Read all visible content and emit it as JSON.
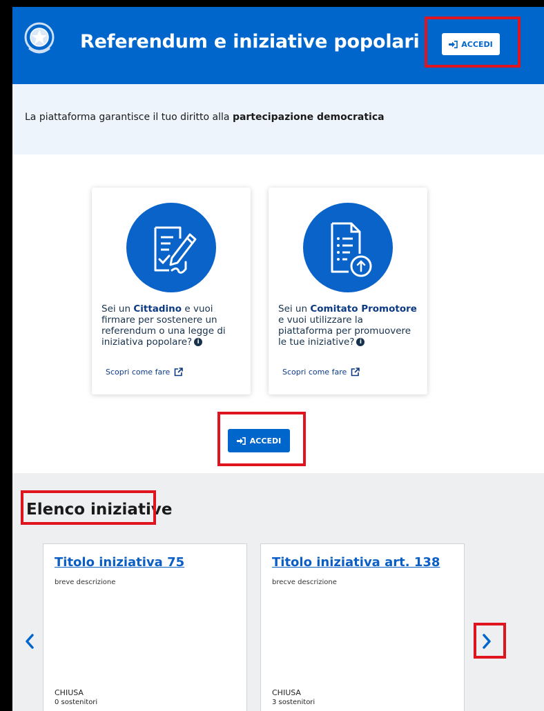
{
  "header": {
    "title": "Referendum e iniziative popolari",
    "login_label": "ACCEDI"
  },
  "intro": {
    "text_plain": "La piattaforma garantisce il tuo diritto alla ",
    "text_bold": "partecipazione democratica"
  },
  "cards": [
    {
      "pre": "Sei un ",
      "role": "Cittadino",
      "post": " e vuoi firmare per sostenere un referendum o una legge di iniziativa popolare?",
      "info": "i",
      "link": "Scopri come fare",
      "icon": "document-sign-icon"
    },
    {
      "pre": "Sei un ",
      "role": "Comitato Promotore",
      "post": " e vuoi utilizzare la piattaforma per promuovere le tue iniziative?",
      "info": "i",
      "link": "Scopri come fare",
      "icon": "document-upload-icon"
    }
  ],
  "main_login_label": "ACCEDI",
  "list": {
    "title": "Elenco iniziative",
    "items": [
      {
        "title": "Titolo iniziativa 75",
        "description": "breve descrizione",
        "status": "CHIUSA",
        "supporters": "0 sostenitori"
      },
      {
        "title": "Titolo iniziativa art. 138",
        "description": "brecve descrizione",
        "status": "CHIUSA",
        "supporters": "3 sostenitori"
      }
    ]
  },
  "colors": {
    "primary": "#0066cc",
    "highlight": "#e0141e",
    "intro_bg": "#eef4fb",
    "list_bg": "#eeeff1"
  }
}
